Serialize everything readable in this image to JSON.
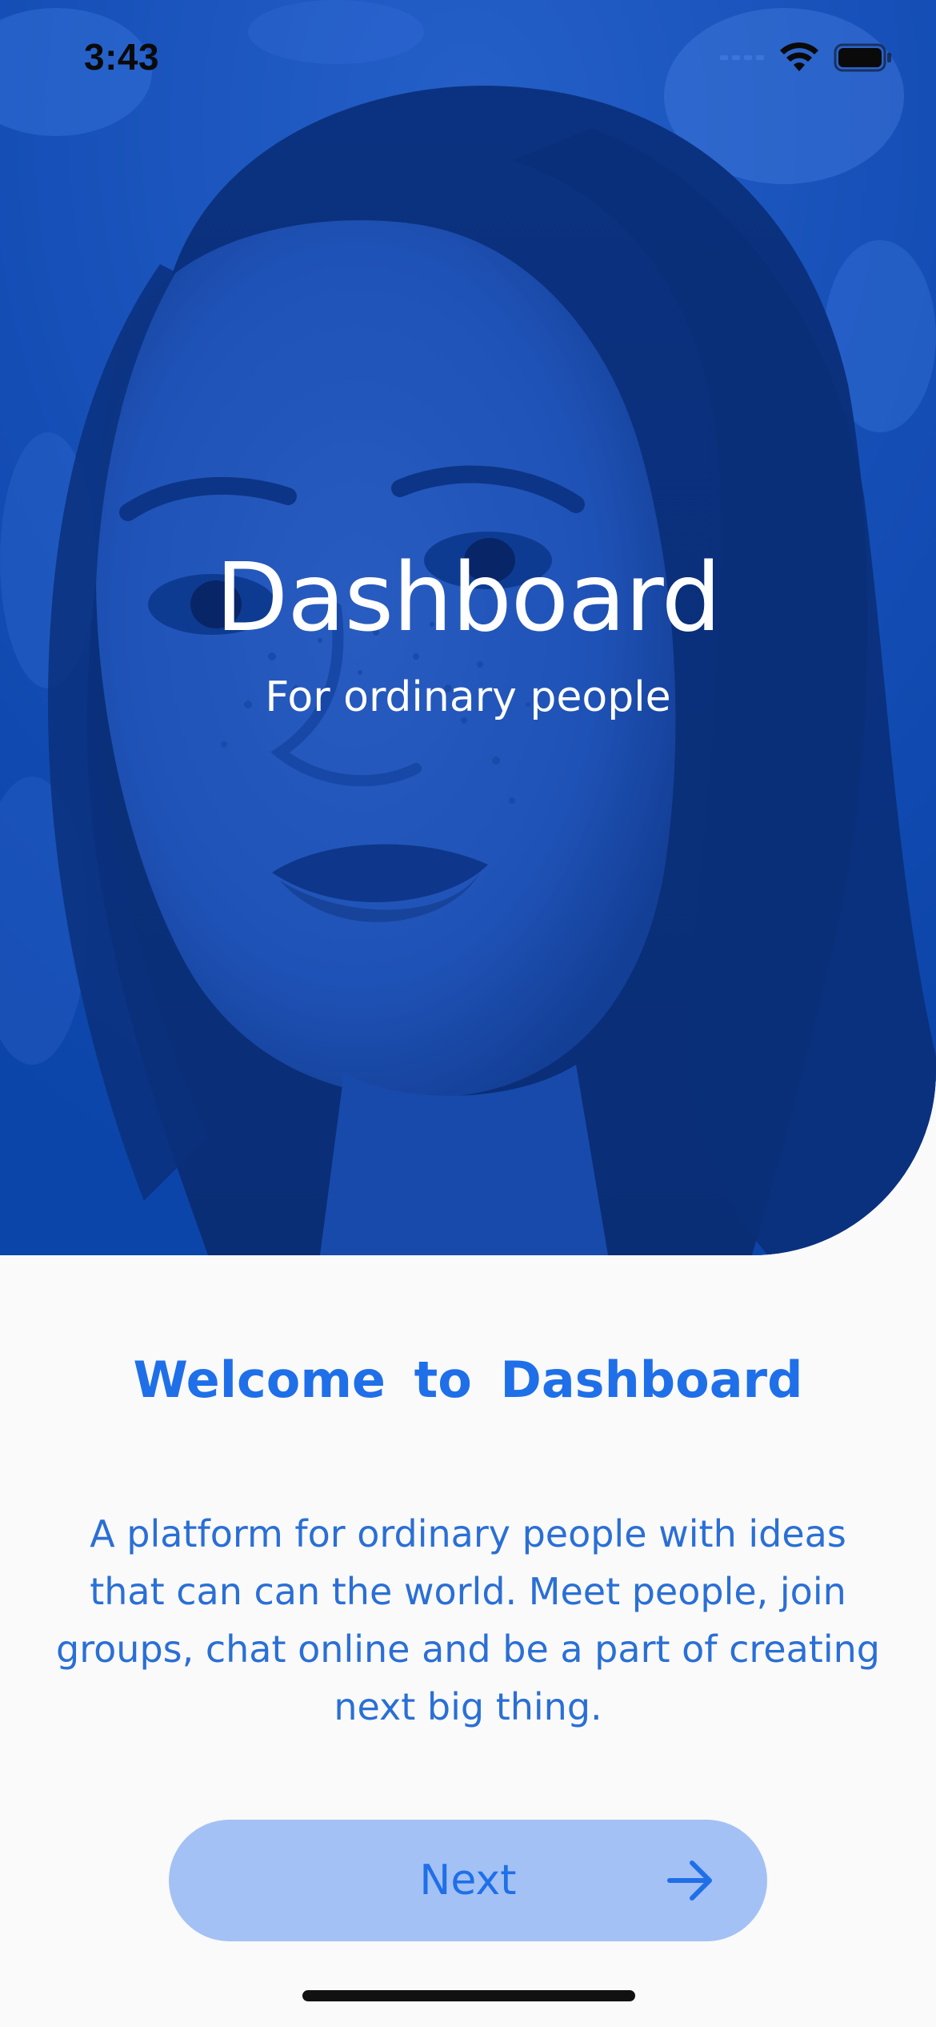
{
  "status_bar": {
    "time": "3:43",
    "icons": [
      "cellular-signal-icon",
      "wifi-icon",
      "battery-icon"
    ]
  },
  "hero": {
    "title": "Dashboard",
    "subtitle": "For ordinary people",
    "background_color": "#0c44a8"
  },
  "content": {
    "welcome_heading": "Welcome to Dashboard",
    "description": "A platform for ordinary people with ideas that can can the world. Meet people, join groups, chat online and be a part of creating next big thing."
  },
  "next_button": {
    "label": "Next",
    "icon": "arrow-right-icon"
  },
  "colors": {
    "accent": "#1f6fe8",
    "button_bg": "#a3c1f4",
    "page_bg": "#fafafa",
    "hero_tint": "#0c44a8"
  }
}
